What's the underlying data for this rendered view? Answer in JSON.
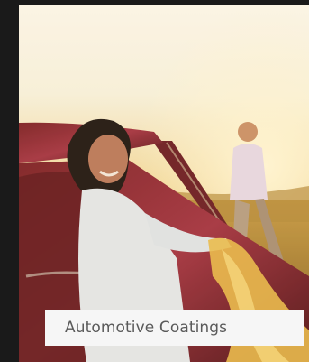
{
  "caption": {
    "label": "Automotive Coatings"
  }
}
